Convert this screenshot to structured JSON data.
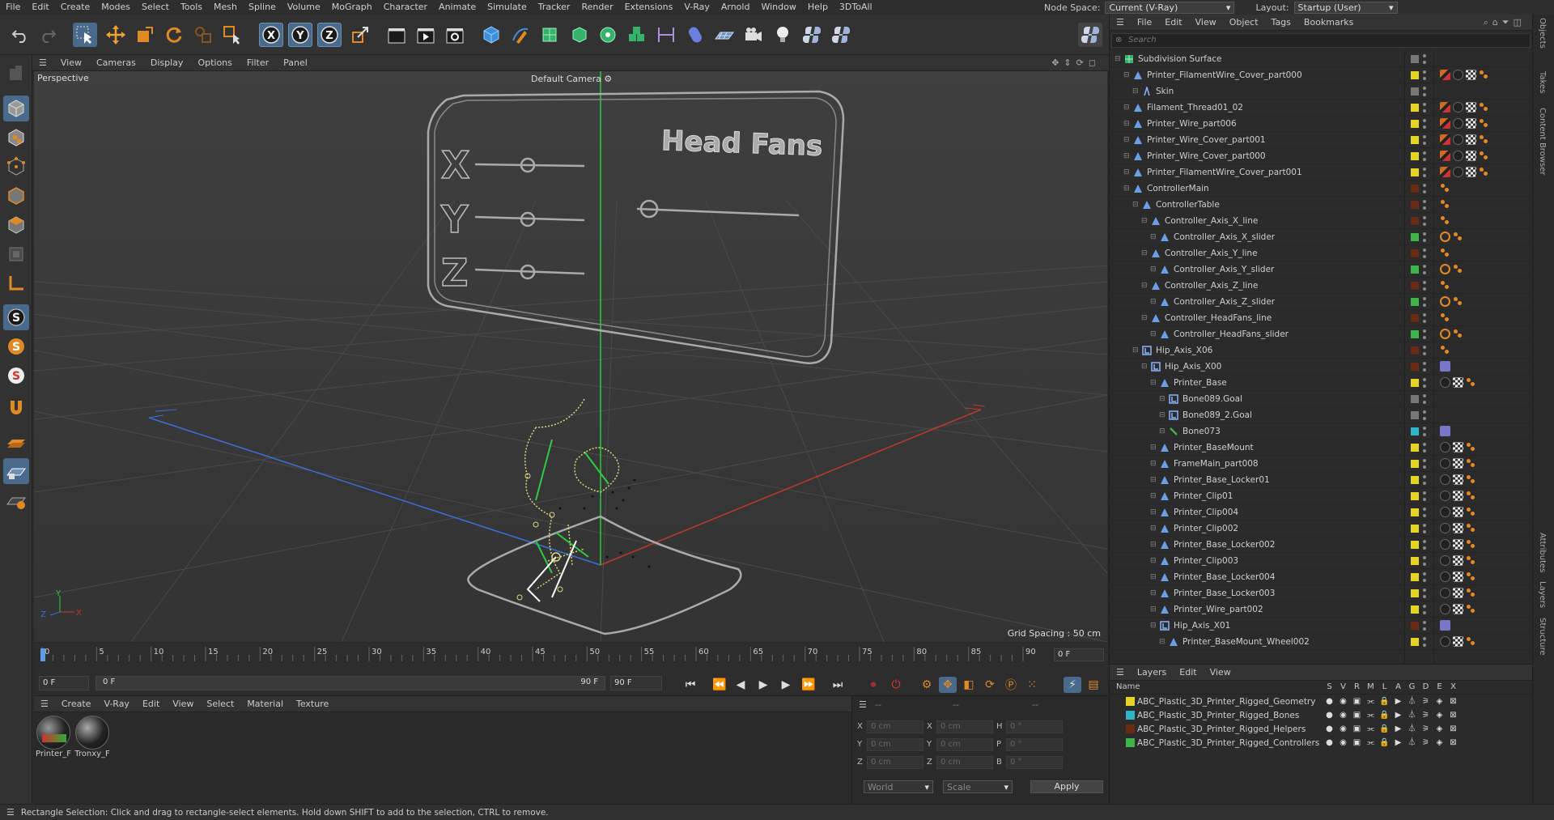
{
  "menu": [
    "File",
    "Edit",
    "Create",
    "Modes",
    "Select",
    "Tools",
    "Mesh",
    "Spline",
    "Volume",
    "MoGraph",
    "Character",
    "Animate",
    "Simulate",
    "Tracker",
    "Render",
    "Extensions",
    "V-Ray",
    "Arnold",
    "Window",
    "Help",
    "3DToAll"
  ],
  "node_space": {
    "label": "Node Space:",
    "value": "Current (V-Ray)"
  },
  "layout": {
    "label": "Layout:",
    "value": "Startup (User)"
  },
  "viewport": {
    "menu": [
      "View",
      "Cameras",
      "Display",
      "Options",
      "Filter",
      "Panel"
    ],
    "projection": "Perspective",
    "camera": "Default Camera",
    "grid_spacing": "Grid Spacing : 50 cm",
    "panel_axes": [
      "X",
      "Y",
      "Z"
    ],
    "panel_title": "Head Fans",
    "axis_labels": {
      "x": "X",
      "y": "Y",
      "z": "Z"
    }
  },
  "timeline": {
    "ticks": [
      "0",
      "5",
      "10",
      "15",
      "20",
      "25",
      "30",
      "35",
      "40",
      "45",
      "50",
      "55",
      "60",
      "65",
      "70",
      "75",
      "80",
      "85",
      "90"
    ],
    "current_frame": "0 F"
  },
  "transport": {
    "start": "0 F",
    "range_start": "0 F",
    "range_end": "90 F",
    "end": "90 F"
  },
  "materials": {
    "menu": [
      "Create",
      "V-Ray",
      "Edit",
      "View",
      "Select",
      "Material",
      "Texture"
    ],
    "items": [
      {
        "label": "Printer_F"
      },
      {
        "label": "Tronxy_F"
      }
    ]
  },
  "coords": {
    "head": [
      "--",
      "--",
      "--"
    ],
    "rows": [
      {
        "a": "X",
        "av": "0 cm",
        "b": "X",
        "bv": "0 cm",
        "c": "H",
        "cv": "0 °"
      },
      {
        "a": "Y",
        "av": "0 cm",
        "b": "Y",
        "bv": "0 cm",
        "c": "P",
        "cv": "0 °"
      },
      {
        "a": "Z",
        "av": "0 cm",
        "b": "Z",
        "bv": "0 cm",
        "c": "B",
        "cv": "0 °"
      }
    ],
    "mode1": "World",
    "mode2": "Scale",
    "apply": "Apply"
  },
  "status": "Rectangle Selection: Click and drag to rectangle-select elements. Hold down SHIFT to add to the selection, CTRL to remove.",
  "object_manager": {
    "menu": [
      "File",
      "Edit",
      "View",
      "Object",
      "Tags",
      "Bookmarks"
    ],
    "search_placeholder": "Search",
    "objects": [
      {
        "name": "Subdivision Surface",
        "depth": 0,
        "icon": "subdivision-icon",
        "color": "#777777",
        "tags": []
      },
      {
        "name": "Printer_FilamentWire_Cover_part000",
        "depth": 1,
        "icon": "mesh-icon",
        "color": "#e6d324",
        "tags": [
          "ck2",
          "ph",
          "ck",
          "ik"
        ]
      },
      {
        "name": "Skin",
        "depth": 2,
        "icon": "skin-icon",
        "color": "#777777",
        "tags": []
      },
      {
        "name": "Filament_Thread01_02",
        "depth": 1,
        "icon": "mesh-icon",
        "color": "#e6d324",
        "tags": [
          "ck2",
          "ph",
          "ck",
          "ik"
        ]
      },
      {
        "name": "Printer_Wire_part006",
        "depth": 1,
        "icon": "mesh-icon",
        "color": "#e6d324",
        "tags": [
          "ck2",
          "ph",
          "ck",
          "ik"
        ]
      },
      {
        "name": "Printer_Wire_Cover_part001",
        "depth": 1,
        "icon": "mesh-icon",
        "color": "#e6d324",
        "tags": [
          "ck2",
          "ph",
          "ck",
          "ik"
        ]
      },
      {
        "name": "Printer_Wire_Cover_part000",
        "depth": 1,
        "icon": "mesh-icon",
        "color": "#e6d324",
        "tags": [
          "ck2",
          "ph",
          "ck",
          "ik"
        ]
      },
      {
        "name": "Printer_FilamentWire_Cover_part001",
        "depth": 1,
        "icon": "mesh-icon",
        "color": "#e6d324",
        "tags": [
          "ck2",
          "ph",
          "ck",
          "ik"
        ]
      },
      {
        "name": "ControllerMain",
        "depth": 1,
        "icon": "mesh-icon",
        "color": "#6b2a14",
        "tags": [
          "ik"
        ]
      },
      {
        "name": "ControllerTable",
        "depth": 2,
        "icon": "mesh-icon",
        "color": "#6b2a14",
        "tags": [
          "ik"
        ]
      },
      {
        "name": "Controller_Axis_X_line",
        "depth": 3,
        "icon": "mesh-icon",
        "color": "#6b2a14",
        "tags": [
          "ik"
        ]
      },
      {
        "name": "Controller_Axis_X_slider",
        "depth": 4,
        "icon": "mesh-icon",
        "color": "#3fb24a",
        "tags": [
          "no",
          "ik"
        ]
      },
      {
        "name": "Controller_Axis_Y_line",
        "depth": 3,
        "icon": "mesh-icon",
        "color": "#6b2a14",
        "tags": [
          "ik"
        ]
      },
      {
        "name": "Controller_Axis_Y_slider",
        "depth": 4,
        "icon": "mesh-icon",
        "color": "#3fb24a",
        "tags": [
          "no",
          "ik"
        ]
      },
      {
        "name": "Controller_Axis_Z_line",
        "depth": 3,
        "icon": "mesh-icon",
        "color": "#6b2a14",
        "tags": [
          "ik"
        ]
      },
      {
        "name": "Controller_Axis_Z_slider",
        "depth": 4,
        "icon": "mesh-icon",
        "color": "#3fb24a",
        "tags": [
          "no",
          "ik"
        ]
      },
      {
        "name": "Controller_HeadFans_line",
        "depth": 3,
        "icon": "mesh-icon",
        "color": "#6b2a14",
        "tags": [
          "ik"
        ]
      },
      {
        "name": "Controller_HeadFans_slider",
        "depth": 4,
        "icon": "mesh-icon",
        "color": "#3fb24a",
        "tags": [
          "no",
          "ik"
        ]
      },
      {
        "name": "Hip_Axis_X06",
        "depth": 2,
        "icon": "joint-icon",
        "color": "#6b2a14",
        "tags": [
          "ik"
        ]
      },
      {
        "name": "Hip_Axis_X00",
        "depth": 3,
        "icon": "joint-icon",
        "color": "#6b2a14",
        "tags": [
          "sp"
        ]
      },
      {
        "name": "Printer_Base",
        "depth": 4,
        "icon": "mesh-icon",
        "color": "#e6d324",
        "tags": [
          "ph",
          "ck",
          "ik"
        ]
      },
      {
        "name": "Bone089.Goal",
        "depth": 5,
        "icon": "joint-icon",
        "color": "#777777",
        "tags": []
      },
      {
        "name": "Bone089_2.Goal",
        "depth": 5,
        "icon": "joint-icon",
        "color": "#777777",
        "tags": []
      },
      {
        "name": "Bone073",
        "depth": 5,
        "icon": "bone-icon",
        "color": "#2fb4c8",
        "tags": [
          "sp"
        ]
      },
      {
        "name": "Printer_BaseMount",
        "depth": 4,
        "icon": "mesh-icon",
        "color": "#e6d324",
        "tags": [
          "ph",
          "ck",
          "ik"
        ]
      },
      {
        "name": "FrameMain_part008",
        "depth": 4,
        "icon": "mesh-icon",
        "color": "#e6d324",
        "tags": [
          "ph",
          "ck",
          "ik"
        ]
      },
      {
        "name": "Printer_Base_Locker01",
        "depth": 4,
        "icon": "mesh-icon",
        "color": "#e6d324",
        "tags": [
          "ph",
          "ck",
          "ik"
        ]
      },
      {
        "name": "Printer_Clip01",
        "depth": 4,
        "icon": "mesh-icon",
        "color": "#e6d324",
        "tags": [
          "ph",
          "ck",
          "ik"
        ]
      },
      {
        "name": "Printer_Clip004",
        "depth": 4,
        "icon": "mesh-icon",
        "color": "#e6d324",
        "tags": [
          "ph",
          "ck",
          "ik"
        ]
      },
      {
        "name": "Printer_Clip002",
        "depth": 4,
        "icon": "mesh-icon",
        "color": "#e6d324",
        "tags": [
          "ph",
          "ck",
          "ik"
        ]
      },
      {
        "name": "Printer_Base_Locker002",
        "depth": 4,
        "icon": "mesh-icon",
        "color": "#e6d324",
        "tags": [
          "ph",
          "ck",
          "ik"
        ]
      },
      {
        "name": "Printer_Clip003",
        "depth": 4,
        "icon": "mesh-icon",
        "color": "#e6d324",
        "tags": [
          "ph",
          "ck",
          "ik"
        ]
      },
      {
        "name": "Printer_Base_Locker004",
        "depth": 4,
        "icon": "mesh-icon",
        "color": "#e6d324",
        "tags": [
          "ph",
          "ck",
          "ik"
        ]
      },
      {
        "name": "Printer_Base_Locker003",
        "depth": 4,
        "icon": "mesh-icon",
        "color": "#e6d324",
        "tags": [
          "ph",
          "ck",
          "ik"
        ]
      },
      {
        "name": "Printer_Wire_part002",
        "depth": 4,
        "icon": "mesh-icon",
        "color": "#e6d324",
        "tags": [
          "ph",
          "ck",
          "ik"
        ]
      },
      {
        "name": "Hip_Axis_X01",
        "depth": 4,
        "icon": "joint-icon",
        "color": "#6b2a14",
        "tags": [
          "sp"
        ]
      },
      {
        "name": "Printer_BaseMount_Wheel002",
        "depth": 5,
        "icon": "mesh-icon",
        "color": "#e6d324",
        "tags": [
          "ph",
          "ck",
          "ik"
        ]
      }
    ]
  },
  "layers": {
    "menu": [
      "Layers",
      "Edit",
      "View"
    ],
    "header": {
      "name": "Name",
      "cols": [
        "S",
        "V",
        "R",
        "M",
        "L",
        "A",
        "G",
        "D",
        "E",
        "X"
      ]
    },
    "items": [
      {
        "name": "ABC_Plastic_3D_Printer_Rigged_Geometry",
        "color": "#e6d324"
      },
      {
        "name": "ABC_Plastic_3D_Printer_Rigged_Bones",
        "color": "#2fb4c8"
      },
      {
        "name": "ABC_Plastic_3D_Printer_Rigged_Helpers",
        "color": "#6b2a14"
      },
      {
        "name": "ABC_Plastic_3D_Printer_Rigged_Controllers",
        "color": "#3fb24a"
      }
    ]
  },
  "side_tabs": [
    "Objects",
    "Takes",
    "Content Browser",
    "Attributes",
    "Layers",
    "Structure"
  ],
  "colors": {
    "accent": "#4a6a8c",
    "x_axis": "#c0392b",
    "y_axis": "#2ecc40",
    "z_axis": "#3a6fd8"
  }
}
